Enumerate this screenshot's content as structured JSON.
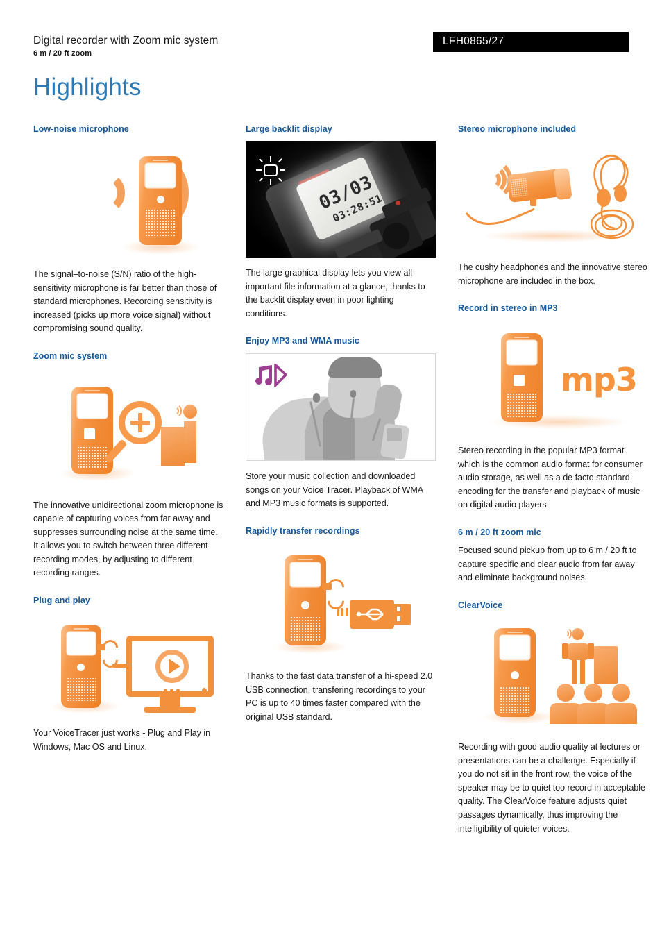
{
  "header": {
    "title": "Digital recorder with Zoom mic system",
    "subtitle": "6 m / 20 ft zoom",
    "product_code": "LFH0865/27",
    "page_heading": "Highlights"
  },
  "colors": {
    "heading_blue": "#2a7ab8",
    "section_blue": "#15599c",
    "orange": "#f5933f",
    "purple": "#9c3f91",
    "code_bg": "#000000"
  },
  "columns": [
    {
      "name": "column-left",
      "sections": [
        {
          "title": "Low-noise microphone",
          "figure": "recorder-with-soundwaves-illustration",
          "text": "The signal–to-noise (S/N) ratio of the high-sensitivity microphone is far better than those of standard microphones. Recording sensitivity is increased (picks up more voice signal) without compromising sound quality."
        },
        {
          "title": "Zoom mic system",
          "figure": "recorder-magnifier-person-illustration",
          "text": "The innovative unidirectional zoom microphone is capable of capturing voices from far away and suppresses surrounding noise at the same time. It allows you to switch between three different recording modes, by adjusting to different recording ranges."
        },
        {
          "title": "Plug and play",
          "figure": "recorder-connected-to-monitor-illustration",
          "text": "Your VoiceTracer just works - Plug and Play in Windows, Mac OS and Linux."
        }
      ]
    },
    {
      "name": "column-middle",
      "sections": [
        {
          "title": "Large backlit display",
          "figure": "backlit-lcd-photo",
          "figure_detail": {
            "icon": "backlight-sun-icon",
            "lcd_file": "03/03",
            "lcd_time": "03:28:51"
          },
          "text": "The large graphical display lets you view all important file information at a glance, thanks to the backlit display even in poor lighting conditions."
        },
        {
          "title": "Enjoy MP3 and WMA music",
          "figure": "man-with-earphones-photo",
          "figure_detail": {
            "icon": "music-note-play-icon"
          },
          "text": "Store your music collection and downloaded songs on your Voice Tracer. Playback of WMA and MP3 music formats is supported."
        },
        {
          "title": "Rapidly transfer recordings",
          "figure": "recorder-usb-connector-illustration",
          "text": "Thanks to the fast data transfer of a hi-speed 2.0 USB connection, transfering recordings to your PC is up to 40 times faster compared with the original USB standard."
        }
      ]
    },
    {
      "name": "column-right",
      "sections": [
        {
          "title": "Stereo microphone included",
          "figure": "stereo-mic-and-earphones-illustration",
          "text": "The cushy headphones and the innovative stereo microphone are included in the box."
        },
        {
          "title": "Record in stereo in MP3",
          "figure": "recorder-mp3-logo-illustration",
          "figure_detail": {
            "logo_text": "mp3"
          },
          "text": "Stereo recording in the popular MP3 format which is the common audio format for consumer audio storage, as well as a de facto standard encoding for the transfer and playback of music on digital audio players."
        },
        {
          "title": "6 m / 20 ft zoom mic",
          "figure": null,
          "text": "Focused sound pickup from up to 6 m / 20 ft to capture specific and clear audio from far away and eliminate background noises."
        },
        {
          "title": "ClearVoice",
          "figure": "recorder-presenter-audience-illustration",
          "text": "Recording with good audio quality at lectures or presentations can be a challenge. Especially if you do not sit in the front row, the voice of the speaker may be to quiet too record in acceptable quality. The ClearVoice feature adjusts quiet passages dynamically, thus improving the intelligibility of quieter voices."
        }
      ]
    }
  ]
}
